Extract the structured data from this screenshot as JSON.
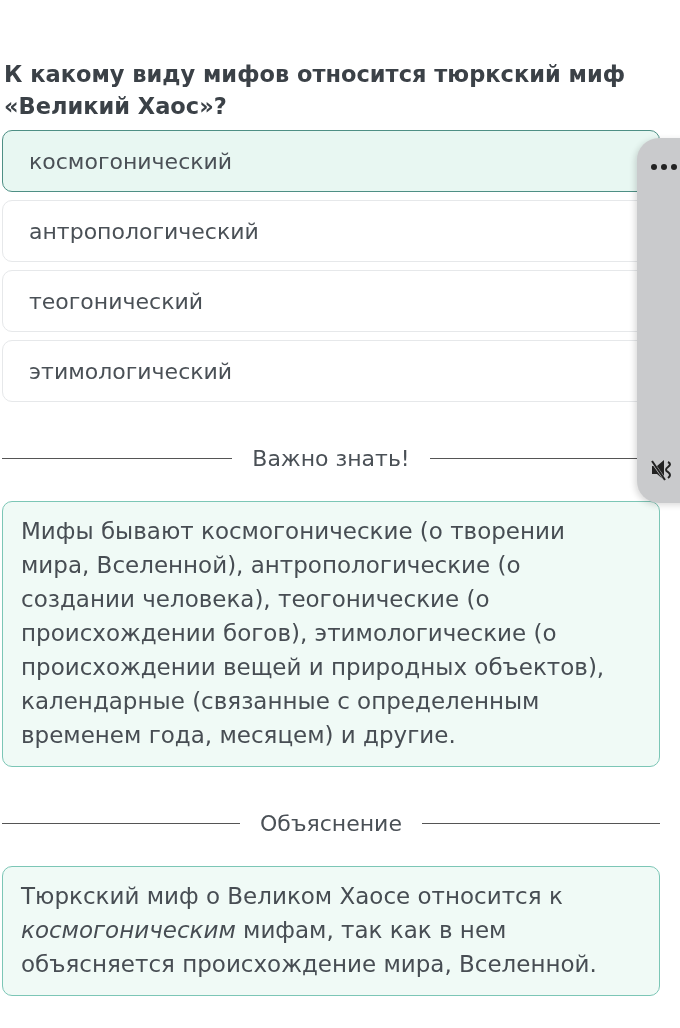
{
  "question": "К какому виду мифов относится тюркский миф «Великий Хаос»?",
  "options": [
    {
      "label": "космогонический",
      "selected": true
    },
    {
      "label": "антропологический",
      "selected": false
    },
    {
      "label": "теогонический",
      "selected": false
    },
    {
      "label": "этимологический",
      "selected": false
    }
  ],
  "sections": [
    {
      "heading": "Важно знать!",
      "text": "Мифы бывают космогонические (о творении мира, Вселенной), антропологические (о создании человека), теогонические (о происхождении богов), этимологические (о происхождении вещей и природных объектов), календарные (связанные с определенным временем года, месяцем) и другие."
    },
    {
      "heading": "Объяснение",
      "text": "Тюркский миф о Великом Хаосе относится к *космогоническим* мифам, так как в нем объясняется происхождение мира, Вселенной."
    }
  ],
  "overlay": {
    "muted": true
  }
}
